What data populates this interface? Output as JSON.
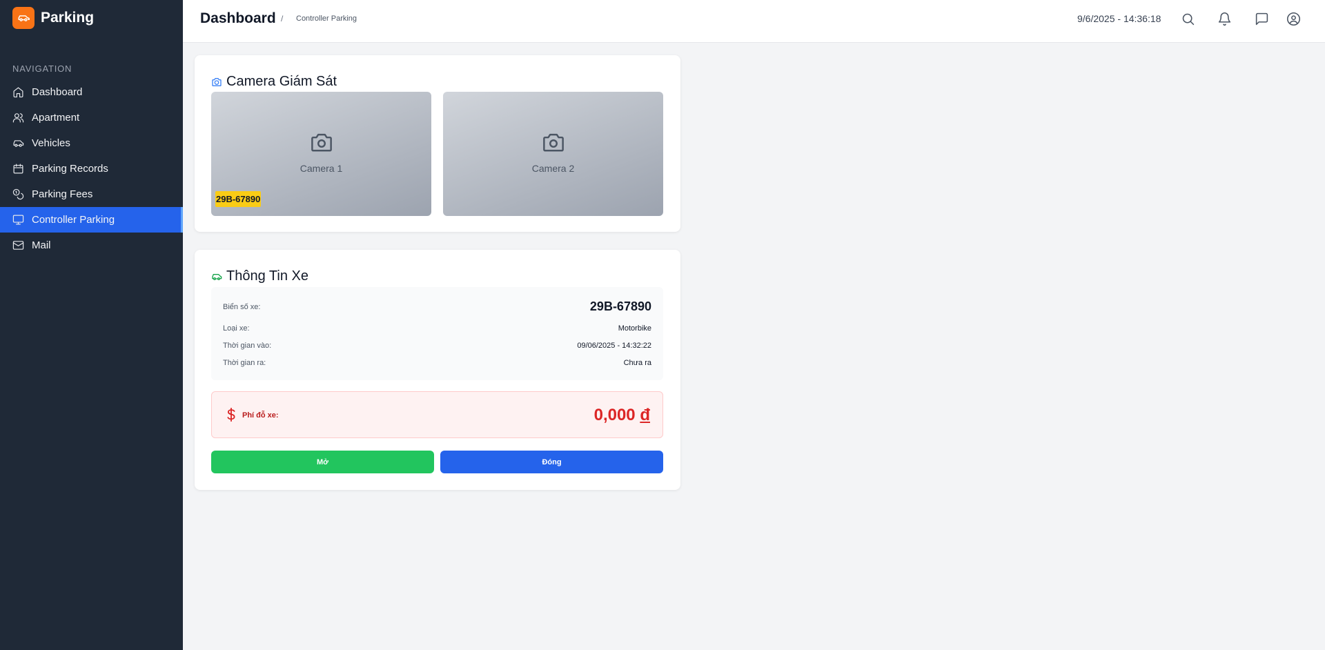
{
  "app": {
    "name": "Parking",
    "logo_icon": "car-icon",
    "brand_color": "#f97316"
  },
  "sidebar": {
    "heading": "NAVIGATION",
    "items": [
      {
        "label": "Dashboard",
        "icon": "home-icon"
      },
      {
        "label": "Apartment",
        "icon": "users-icon"
      },
      {
        "label": "Vehicles",
        "icon": "car-icon"
      },
      {
        "label": "Parking Records",
        "icon": "calendar-icon"
      },
      {
        "label": "Parking Fees",
        "icon": "coins-icon"
      },
      {
        "label": "Controller Parking",
        "icon": "monitor-icon",
        "active": true
      },
      {
        "label": "Mail",
        "icon": "mail-icon"
      }
    ]
  },
  "header": {
    "title": "Dashboard",
    "separator": "/",
    "breadcrumb": "Controller Parking",
    "datetime": "9/6/2025 - 14:36:18",
    "icons": [
      "search-icon",
      "bell-icon",
      "message-icon",
      "user-circle-icon"
    ]
  },
  "camera_panel": {
    "title": "Camera Giám Sát",
    "cameras": [
      {
        "label": "Camera 1",
        "plate": "29B-67890"
      },
      {
        "label": "Camera 2"
      }
    ]
  },
  "vehicle_info": {
    "title": "Thông Tin Xe",
    "plate_label": "Biển số xe:",
    "plate_value": "29B-67890",
    "type_label": "Loại xe:",
    "type_value": "Motorbike",
    "time_in_label": "Thời gian vào:",
    "time_in_value": "09/06/2025 - 14:32:22",
    "time_out_label": "Thời gian ra:",
    "time_out_value": "Chưa ra",
    "fee_label": "Phí đỗ xe:",
    "fee_amount": "0,000",
    "fee_currency": "đ",
    "open_label": "Mở",
    "close_label": "Đóng"
  },
  "colors": {
    "sidebar_bg": "#1f2937",
    "active_nav": "#2563eb",
    "plate_badge": "#facc15",
    "fee_red": "#dc2626",
    "open_green": "#22c55e",
    "close_blue": "#2563eb"
  }
}
